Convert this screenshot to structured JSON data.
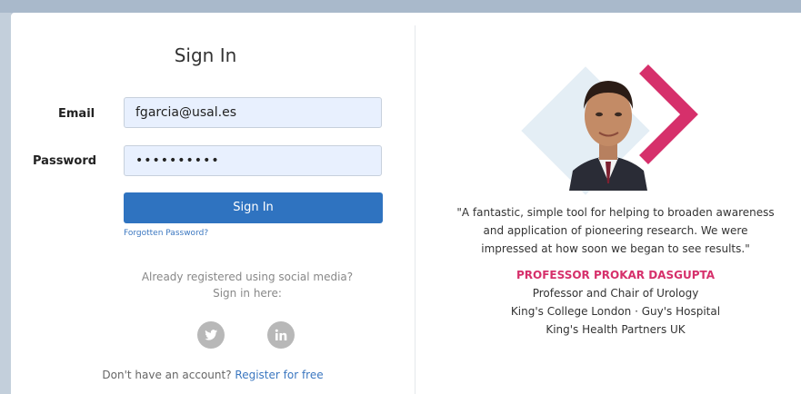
{
  "signin": {
    "title": "Sign In",
    "email_label": "Email",
    "email_value": "fgarcia@usal.es",
    "password_label": "Password",
    "password_value": "••••••••••",
    "button_label": "Sign In",
    "forgot_label": "Forgotten Password?",
    "social_line1": "Already registered using social media?",
    "social_line2": "Sign in here:",
    "no_account_text": "Don't have an account?",
    "register_label": "Register for free"
  },
  "testimonial": {
    "quote_line1": "\"A fantastic, simple tool for helping to broaden awareness",
    "quote_line2": "and application of pioneering research. We were",
    "quote_line3": "impressed at how soon we began to see results.\"",
    "name": "PROFESSOR PROKAR DASGUPTA",
    "line1": "Professor and Chair of Urology",
    "line2": "King's College London · Guy's Hospital",
    "line3": "King's Health Partners UK"
  },
  "colors": {
    "accent": "#2f73c0",
    "brand_pink": "#d6306b",
    "link": "#3b77c0"
  },
  "icons": [
    "twitter-icon",
    "linkedin-icon"
  ]
}
